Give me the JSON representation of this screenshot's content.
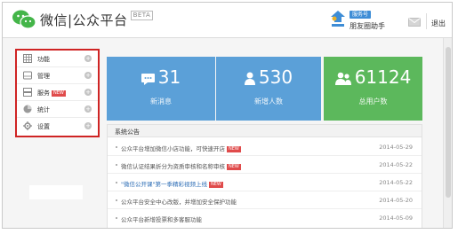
{
  "header": {
    "title": "微信|公众平台",
    "beta": "BETA",
    "account_tag": "服务号",
    "account_name": "朋友圈助手",
    "logout": "退出"
  },
  "sidebar": {
    "items": [
      {
        "label": "功能",
        "icon": "grid-icon",
        "new": ""
      },
      {
        "label": "管理",
        "icon": "tray-icon",
        "new": ""
      },
      {
        "label": "服务",
        "icon": "server-icon",
        "new": "NEW"
      },
      {
        "label": "统计",
        "icon": "pie-icon",
        "new": ""
      },
      {
        "label": "设置",
        "icon": "gear-icon",
        "new": ""
      }
    ]
  },
  "stats": [
    {
      "value": "31",
      "label": "新消息",
      "icon": "message-icon",
      "color": "#5ba0d8"
    },
    {
      "value": "530",
      "label": "新增人数",
      "icon": "person-icon",
      "color": "#5ba0d8"
    },
    {
      "value": "61124",
      "label": "总用户数",
      "icon": "users-icon",
      "color": "#5cb85c"
    }
  ],
  "notices": {
    "title": "系统公告",
    "items": [
      {
        "text": "公众平台增加微信小店功能，可快速开店",
        "date": "2014-05-29",
        "new": "NEW",
        "highlight": false
      },
      {
        "text": "微信认证结果折分为资质审核和名称审核",
        "date": "2014-05-22",
        "new": "NEW",
        "highlight": false
      },
      {
        "text": "\"微信公开课\"第一季精彩视频上线",
        "date": "2014-05-22",
        "new": "NEW",
        "highlight": true
      },
      {
        "text": "公众平台安全中心改版，并增加安全保护功能",
        "date": "2014-05-20",
        "new": "",
        "highlight": false
      },
      {
        "text": "公众平台新增投票和多客服功能",
        "date": "2014-05-09",
        "new": "",
        "highlight": false
      }
    ]
  },
  "colors": {
    "accent_red": "#cf2424",
    "tile_blue": "#5ba0d8",
    "tile_green": "#5cb85c",
    "wechat_green": "#44b549"
  }
}
